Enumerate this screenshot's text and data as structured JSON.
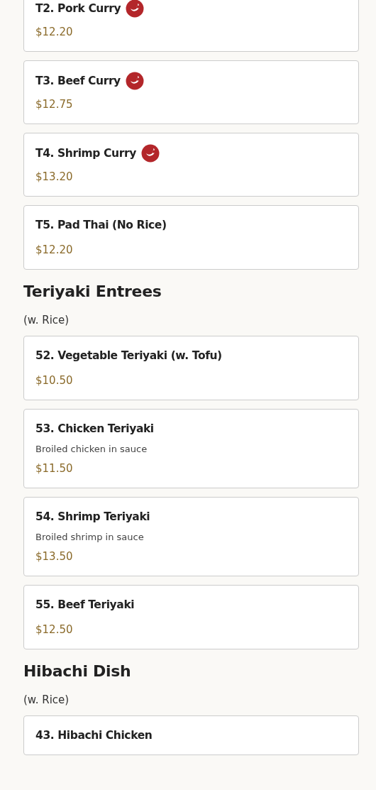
{
  "sections": [
    {
      "items": [
        {
          "name": "T2. Pork Curry",
          "spicy": true,
          "price": "$12.20"
        },
        {
          "name": "T3. Beef Curry",
          "spicy": true,
          "price": "$12.75"
        },
        {
          "name": "T4. Shrimp Curry",
          "spicy": true,
          "price": "$13.20"
        },
        {
          "name": "T5. Pad Thai (No Rice)",
          "spicy": false,
          "price": "$12.20"
        }
      ]
    },
    {
      "title": "Teriyaki Entrees",
      "note": "(w. Rice)",
      "items": [
        {
          "name": "52. Vegetable Teriyaki (w. Tofu)",
          "spicy": false,
          "price": "$10.50"
        },
        {
          "name": "53. Chicken Teriyaki",
          "spicy": false,
          "description": "Broiled chicken in sauce",
          "price": "$11.50"
        },
        {
          "name": "54. Shrimp Teriyaki",
          "spicy": false,
          "description": "Broiled shrimp in sauce",
          "price": "$13.50"
        },
        {
          "name": "55. Beef Teriyaki",
          "spicy": false,
          "price": "$12.50"
        }
      ]
    },
    {
      "title": "Hibachi Dish",
      "note": "(w. Rice)",
      "items": [
        {
          "name": "43. Hibachi Chicken",
          "spicy": false
        }
      ]
    }
  ]
}
